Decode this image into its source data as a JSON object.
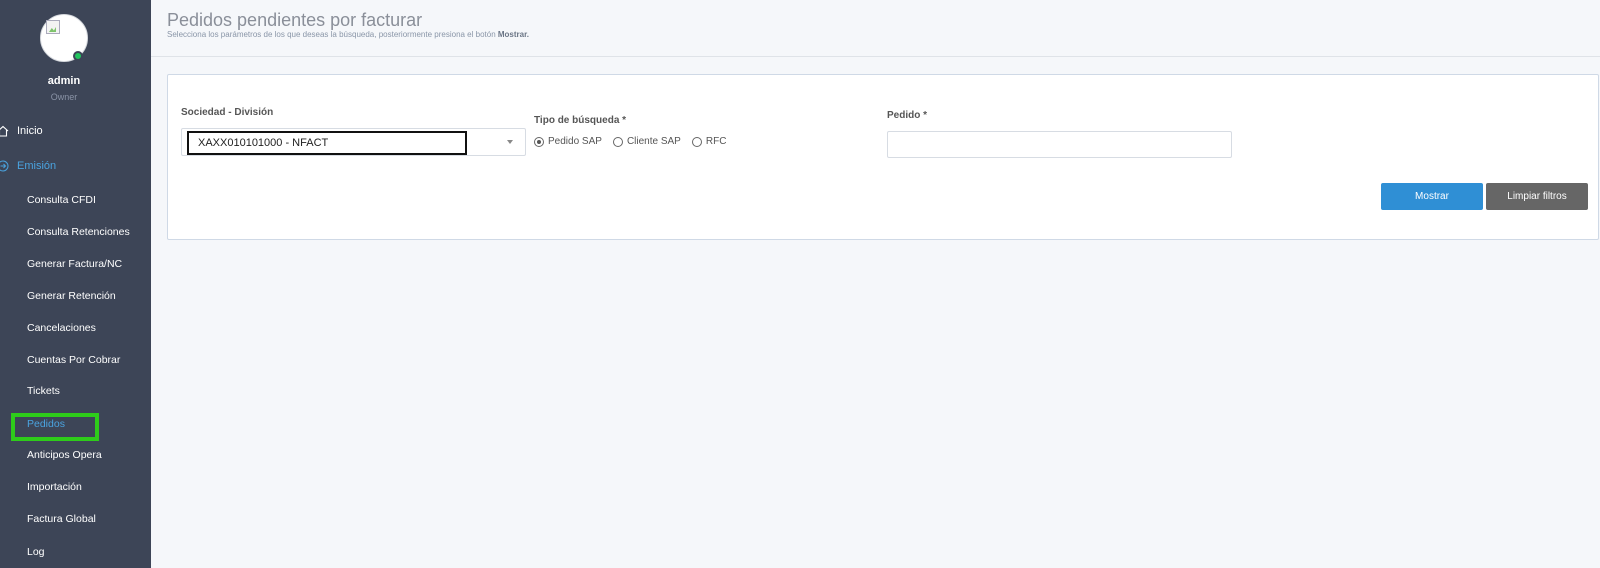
{
  "sidebar": {
    "user": {
      "name": "admin",
      "role": "Owner"
    },
    "menu": {
      "inicio": "Inicio",
      "emision": "Emisión",
      "items": [
        "Consulta CFDI",
        "Consulta Retenciones",
        "Generar Factura/NC",
        "Generar Retención",
        "Cancelaciones",
        "Cuentas Por Cobrar",
        "Tickets",
        "Pedidos",
        "Anticipos Opera",
        "Importación",
        "Factura Global",
        "Log"
      ],
      "current_item": "Pedidos"
    }
  },
  "header": {
    "title": "Pedidos pendientes por facturar",
    "subtitle_prefix": "Selecciona los parámetros de los que deseas la búsqueda, posteriormente presiona el botón ",
    "subtitle_button": "Mostrar."
  },
  "form": {
    "sociedad_label": "Sociedad - División",
    "sociedad_value": "XAXX010101000 - NFACT",
    "tipo_label": "Tipo de búsqueda *",
    "tipo_options": [
      "Pedido SAP",
      "Cliente SAP",
      "RFC"
    ],
    "tipo_selected": "Pedido SAP",
    "pedido_label": "Pedido *",
    "pedido_value": "",
    "mostrar_button": "Mostrar",
    "limpiar_button": "Limpiar filtros"
  },
  "colors": {
    "sidebar_bg": "#3d4557",
    "accent": "#4aa3df",
    "primary_button": "#2f8fd5",
    "secondary_button": "#666666",
    "highlight": "#2ecc1a"
  }
}
